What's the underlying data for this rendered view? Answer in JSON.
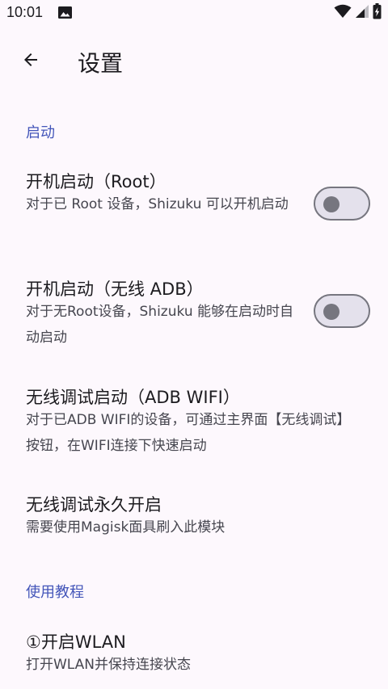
{
  "status_bar": {
    "time": "10:01",
    "icons": [
      "image-icon",
      "wifi-icon",
      "signal-icon",
      "battery-charging-icon"
    ]
  },
  "app_bar": {
    "back_icon": "arrow-back-icon",
    "title": "设置"
  },
  "sections": {
    "startup": {
      "header": "启动",
      "root_boot": {
        "title": "开机启动（Root）",
        "summary": "对于已 Root 设备，Shizuku 可以开机启动",
        "switch_on": false
      },
      "wireless_adb_boot": {
        "title": "开机启动（无线 ADB）",
        "summary": "对于无Root设备，Shizuku 能够在启动时自动启动",
        "switch_on": false
      },
      "adb_wifi_start": {
        "title": "无线调试启动（ADB WIFI）",
        "summary": "对于已ADB WIFI的设备，可通过主界面【无线调试】按钮，在WIFI连接下快速启动"
      },
      "wireless_debug_permanent": {
        "title": "无线调试永久开启",
        "summary": "需要使用Magisk面具刷入此模块"
      }
    },
    "tutorial": {
      "header": "使用教程",
      "step1": {
        "title": "①开启WLAN",
        "summary": "打开WLAN并保持连接状态"
      }
    }
  },
  "colors": {
    "background": "#fdf8fd",
    "accent": "#4355b9",
    "switch_outline": "#76767f",
    "switch_track": "#e4e1ec"
  }
}
